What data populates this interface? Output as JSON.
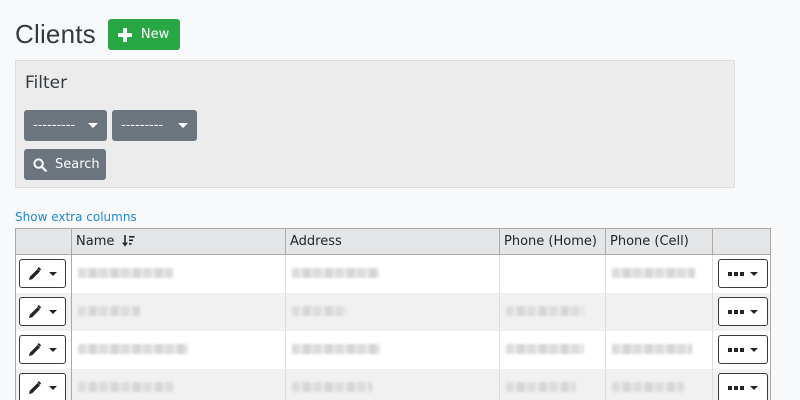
{
  "page": {
    "title": "Clients",
    "new_label": "New"
  },
  "filter": {
    "title": "Filter",
    "dropdown1": "---------",
    "dropdown2": "---------",
    "search_label": "Search"
  },
  "extra_columns_link": "Show extra columns",
  "table": {
    "headers": {
      "name": "Name",
      "address": "Address",
      "phone_home": "Phone (Home)",
      "phone_cell": "Phone (Cell)"
    },
    "rows_redacted": [
      {
        "name": true,
        "address": true,
        "phone_home": false,
        "phone_cell": true
      },
      {
        "name": true,
        "address": true,
        "phone_home": true,
        "phone_cell": false
      },
      {
        "name": true,
        "address": true,
        "phone_home": true,
        "phone_cell": true
      },
      {
        "name": true,
        "address": true,
        "phone_home": true,
        "phone_cell": true
      }
    ]
  },
  "colors": {
    "primary_green": "#28a745",
    "secondary_gray": "#6c757d",
    "link_blue": "#1e88d6",
    "background": "#f8f9fa"
  }
}
